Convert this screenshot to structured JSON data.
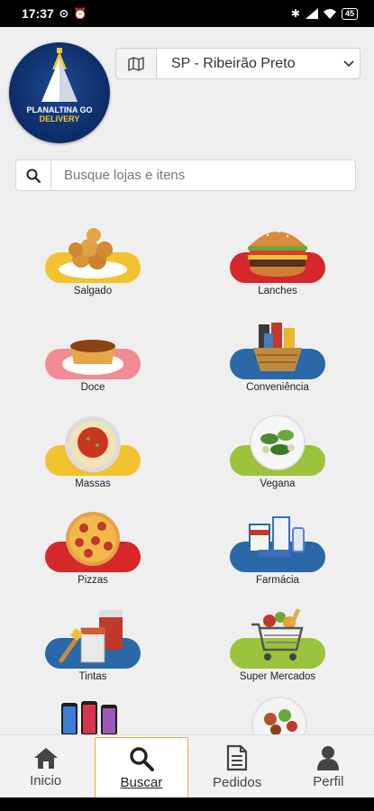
{
  "status_bar": {
    "time": "17:37",
    "battery": "45"
  },
  "logo": {
    "line1": "PLANALTINA GO",
    "line2": "DELIVERY"
  },
  "city_select": {
    "value": "SP - Ribeirão Preto"
  },
  "search": {
    "placeholder": "Busque lojas e itens"
  },
  "categories": [
    {
      "label": "Salgado",
      "pill_color": "#f2c230",
      "icon": "salgado-icon"
    },
    {
      "label": "Lanches",
      "pill_color": "#d6272a",
      "icon": "burger-icon"
    },
    {
      "label": "Doce",
      "pill_color": "#f28b94",
      "icon": "pudding-icon"
    },
    {
      "label": "Conveniência",
      "pill_color": "#2a68a8",
      "icon": "basket-icon"
    },
    {
      "label": "Massas",
      "pill_color": "#f2c230",
      "icon": "pasta-icon"
    },
    {
      "label": "Vegana",
      "pill_color": "#9bc33b",
      "icon": "salad-icon"
    },
    {
      "label": "Pizzas",
      "pill_color": "#d6272a",
      "icon": "pizza-icon"
    },
    {
      "label": "Farmácia",
      "pill_color": "#2a68a8",
      "icon": "pharmacy-icon"
    },
    {
      "label": "Tintas",
      "pill_color": "#2a68a8",
      "icon": "paint-icon"
    },
    {
      "label": "Super Mercados",
      "pill_color": "#9bc33b",
      "icon": "cart-icon"
    }
  ],
  "bottom_nav": [
    {
      "label": "Inicio",
      "icon": "home-icon",
      "active": false
    },
    {
      "label": "Buscar",
      "icon": "search-icon",
      "active": true
    },
    {
      "label": "Pedidos",
      "icon": "document-icon",
      "active": false
    },
    {
      "label": "Perfil",
      "icon": "user-icon",
      "active": false
    }
  ]
}
